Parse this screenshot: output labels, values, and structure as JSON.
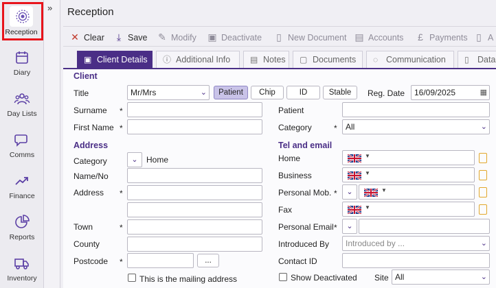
{
  "sidebar": {
    "items": [
      {
        "label": "Reception",
        "icon": "reception-icon"
      },
      {
        "label": "Diary",
        "icon": "calendar-icon"
      },
      {
        "label": "Day Lists",
        "icon": "people-icon"
      },
      {
        "label": "Comms",
        "icon": "chat-icon"
      },
      {
        "label": "Finance",
        "icon": "trend-icon"
      },
      {
        "label": "Reports",
        "icon": "pie-chart-icon"
      },
      {
        "label": "Inventory",
        "icon": "truck-icon"
      }
    ],
    "collapse_glyph": "»"
  },
  "page": {
    "title": "Reception"
  },
  "toolbar": {
    "clear": "Clear",
    "save": "Save",
    "modify": "Modify",
    "deactivate": "Deactivate",
    "new_document": "New Document",
    "accounts": "Accounts",
    "payments": "Payments",
    "more": "A"
  },
  "tabs": [
    "Client Details",
    "Additional Info",
    "Notes",
    "Documents",
    "Communication",
    "Data"
  ],
  "client": {
    "section": "Client",
    "title_label": "Title",
    "title_value": "Mr/Mrs",
    "type_buttons": [
      "Patient",
      "Chip",
      "ID",
      "Stable"
    ],
    "reg_date_label": "Reg. Date",
    "reg_date_value": "16/09/2025",
    "surname_label": "Surname",
    "first_name_label": "First Name",
    "patient_label": "Patient",
    "category_label": "Category",
    "category_value": "All"
  },
  "address": {
    "section": "Address",
    "category_label": "Category",
    "category_value": "Home",
    "name_no_label": "Name/No",
    "address_label": "Address",
    "town_label": "Town",
    "county_label": "County",
    "postcode_label": "Postcode",
    "lookup_button": "...",
    "mailing_label": "This is the mailing address"
  },
  "tel": {
    "section": "Tel and email",
    "home_label": "Home",
    "business_label": "Business",
    "personal_mob_label": "Personal Mob.",
    "fax_label": "Fax",
    "personal_email_label": "Personal Email",
    "introduced_by_label": "Introduced By",
    "introduced_by_placeholder": "Introduced by ...",
    "contact_id_label": "Contact ID",
    "show_deactivated_label": "Show Deactivated",
    "site_label": "Site",
    "site_value": "All"
  },
  "required_mark": "*",
  "colors": {
    "accent": "#4a2e86",
    "highlight": "#e8141b",
    "clipboard": "#e2a72a"
  }
}
